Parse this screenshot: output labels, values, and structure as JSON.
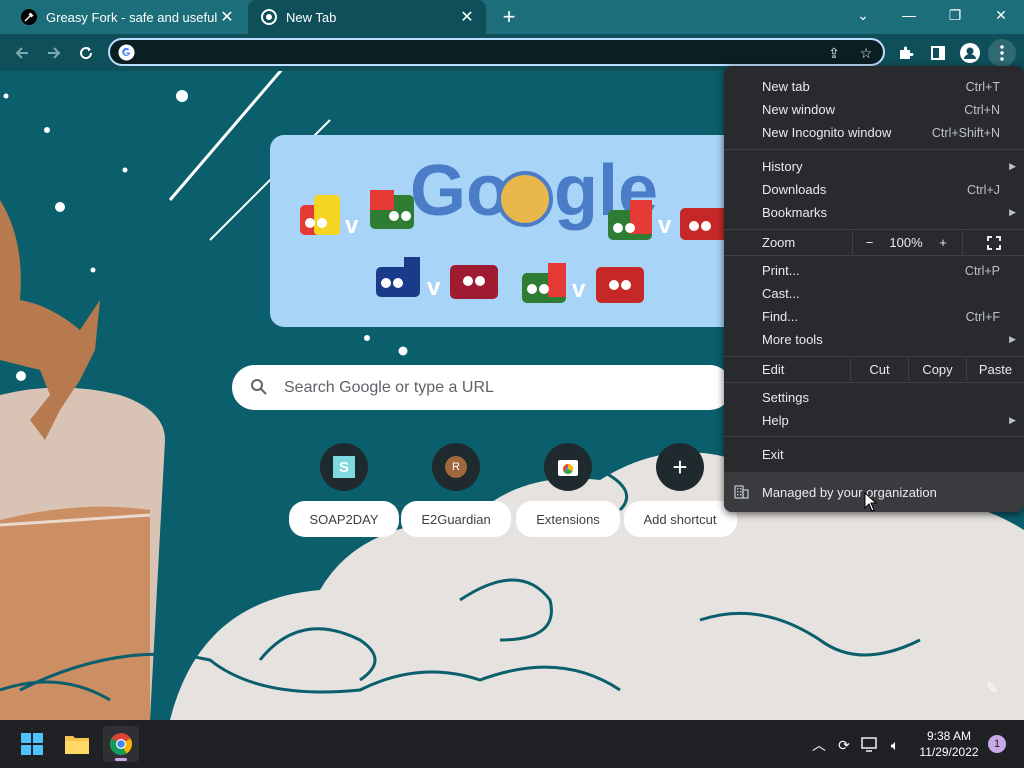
{
  "tabs": [
    {
      "title": "Greasy Fork - safe and useful use",
      "close": "✕"
    },
    {
      "title": "New Tab",
      "close": "✕"
    }
  ],
  "new_tab_symbol": "+",
  "window_controls": {
    "dropdown": "⌄",
    "minimize": "—",
    "restore": "❐",
    "close": "✕"
  },
  "toolbar": {
    "back_icon": "arrow-left-icon",
    "forward_icon": "arrow-right-icon",
    "reload_icon": "reload-icon",
    "url": ""
  },
  "doodle": {
    "word": "Google"
  },
  "search": {
    "placeholder": "Search Google or type a URL"
  },
  "shortcuts": [
    {
      "label": "SOAP2DAY",
      "glyph": "S"
    },
    {
      "label": "E2Guardian",
      "glyph": "R"
    },
    {
      "label": "Extensions",
      "glyph": ""
    },
    {
      "label": "Add shortcut",
      "glyph": "+"
    }
  ],
  "menu": {
    "new_tab": {
      "label": "New tab",
      "shortcut": "Ctrl+T"
    },
    "new_window": {
      "label": "New window",
      "shortcut": "Ctrl+N"
    },
    "new_incognito": {
      "label": "New Incognito window",
      "shortcut": "Ctrl+Shift+N"
    },
    "history": {
      "label": "History"
    },
    "downloads": {
      "label": "Downloads",
      "shortcut": "Ctrl+J"
    },
    "bookmarks": {
      "label": "Bookmarks"
    },
    "zoom": {
      "label": "Zoom",
      "minus": "−",
      "value": "100%",
      "plus": "+"
    },
    "print": {
      "label": "Print...",
      "shortcut": "Ctrl+P"
    },
    "cast": {
      "label": "Cast..."
    },
    "find": {
      "label": "Find...",
      "shortcut": "Ctrl+F"
    },
    "more_tools": {
      "label": "More tools"
    },
    "edit": {
      "label": "Edit",
      "cut": "Cut",
      "copy": "Copy",
      "paste": "Paste"
    },
    "settings": {
      "label": "Settings"
    },
    "help": {
      "label": "Help"
    },
    "exit": {
      "label": "Exit"
    },
    "managed": {
      "label": "Managed by your organization"
    }
  },
  "taskbar": {
    "time": "9:38 AM",
    "date": "11/29/2022",
    "notification_count": "1"
  },
  "colors": {
    "tabstrip": "#1b6e7a",
    "toolbar": "#0f4f59",
    "background": "#0b5e6b",
    "menu": "#292a2d",
    "doodle_bg": "#a8d4f7"
  }
}
